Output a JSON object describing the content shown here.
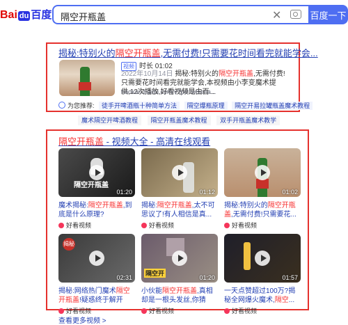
{
  "header": {
    "logo": {
      "bai": "Bai",
      "du": "du",
      "cn": "百度"
    },
    "query": "隔空开瓶盖",
    "search_button": "百度一下",
    "clear_icon": "close-icon",
    "camera_icon": "camera-icon"
  },
  "result1": {
    "title_pre": "揭秘:特别火的",
    "title_hl": "隔空开瓶盖",
    "title_post": ",无需付费!只需要花时间看完就能学会...",
    "tag": "视频",
    "duration_label": "时长 01:02",
    "date": "2022年10月14日",
    "desc_pre": "揭秘:特别火的",
    "desc_hl": "隔空开瓶盖",
    "desc_post": ",无需付费!只需要花时间看完就能学会,本视频由小李变魔术提供,12次播放,好看视频是由百...",
    "url": "haokan.baidu.com/v?pd=wisena...",
    "rec_label": "为您推荐:",
    "recs": [
      "徒手开啤酒瓶十种简单方法",
      "隔空爆瓶原理",
      "隔空开易拉罐瓶盖魔术教程"
    ]
  },
  "related": [
    "魔术隔空开啤酒教程",
    "隔空开瓶盖魔术教程",
    "双手开瓶盖魔术教学"
  ],
  "result2": {
    "title_hl": "隔空开瓶盖",
    "title_post": " - 视频大全 - 高清在线观看",
    "videos": [
      {
        "thumb_text": "隔空开瓶盖",
        "duration": "01:20",
        "t1": "魔术揭秘:",
        "hl": "隔空开瓶盖",
        "t2": ",到底是什么原理?",
        "source": "好看视频"
      },
      {
        "thumb_text": "",
        "duration": "01:12",
        "t1": "揭秘:",
        "hl": "隔空开瓶盖",
        "t2": ",太不可思议了!有人相信是真...",
        "source": "好看视频"
      },
      {
        "thumb_text": "",
        "duration": "01:02",
        "t1": "揭秘:特别火的",
        "hl": "隔空开瓶盖",
        "t2": ",无需付费!只需要花...",
        "source": "好看视频"
      },
      {
        "thumb_text": "揭秘",
        "duration": "02:31",
        "t1": "揭秘:网络热门魔术",
        "hl": "隔空开瓶盖",
        "t2": "!疑惑终于解开",
        "source": "好看视频"
      },
      {
        "thumb_text": "隔空开",
        "duration": "01:20",
        "t1": "小伙能",
        "hl": "隔空开瓶盖",
        "t2": ",真相却是一根头发丝,你猜是...",
        "source": "好看视频"
      },
      {
        "thumb_text": "",
        "duration": "01:57",
        "t1": "一天点赞超过100万?揭秘全网爆火魔术,",
        "hl": "隔空",
        "t2": "...",
        "source": "好看视频"
      }
    ]
  },
  "more_label": "查看更多视频 >"
}
